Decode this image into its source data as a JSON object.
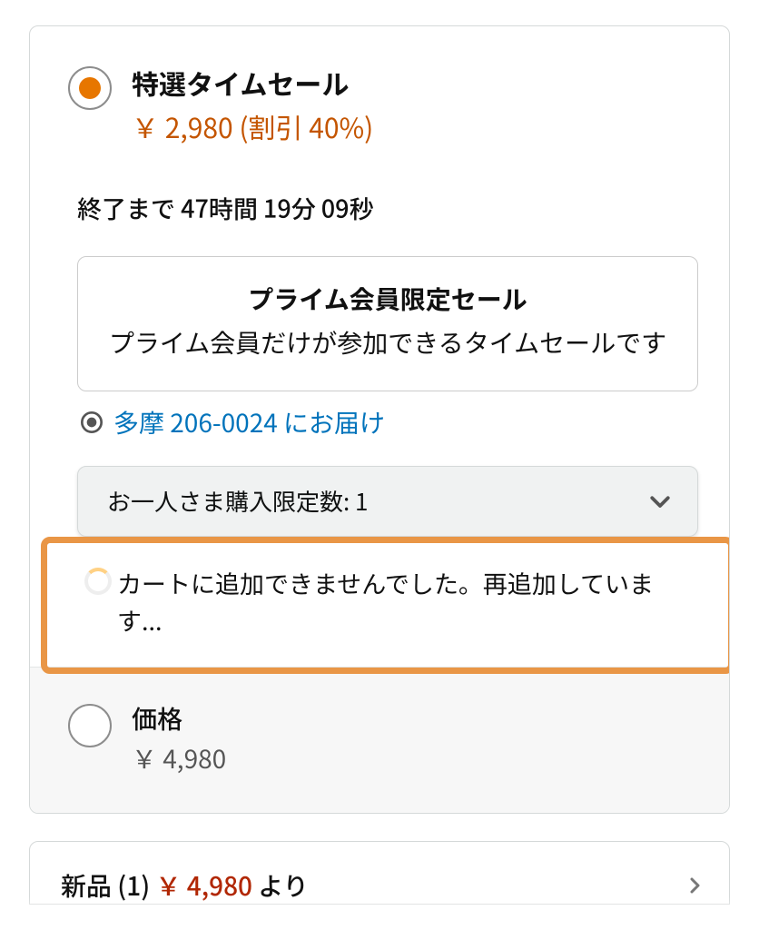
{
  "option1": {
    "title": "特選タイムセール",
    "price": "￥ 2,980 (割引 40%)",
    "countdown": "終了まで 47時間 19分 09秒",
    "primeTitle": "プライム会員限定セール",
    "primeDesc": "プライム会員だけが参加できるタイムセールです",
    "deliverTo": "多摩 206-0024 にお届け",
    "qtyLabel": "お一人さま購入限定数:  1",
    "error": "カートに追加できませんでした。再追加しています..."
  },
  "option2": {
    "label": "価格",
    "price": "￥ 4,980"
  },
  "newOffer": {
    "prefix": "新品 (1) ",
    "price": "￥ 4,980",
    "suffix": " より"
  }
}
